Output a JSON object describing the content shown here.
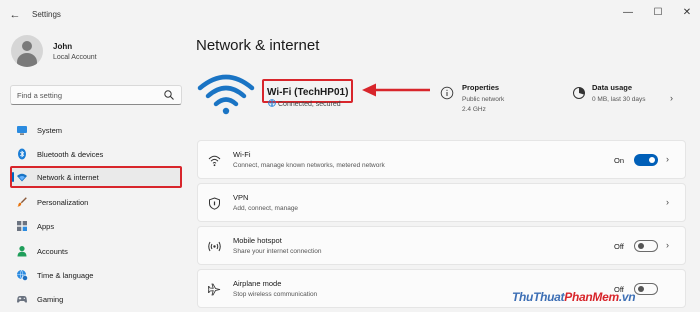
{
  "window": {
    "title": "Settings",
    "back_glyph": "←",
    "minimize_glyph": "—",
    "maximize_glyph": "☐",
    "close_glyph": "✕"
  },
  "user": {
    "name": "John",
    "account": "Local Account"
  },
  "search": {
    "placeholder": "Find a setting",
    "icon": "search-icon"
  },
  "nav": {
    "items": [
      {
        "label": "System",
        "icon": "monitor-icon"
      },
      {
        "label": "Bluetooth & devices",
        "icon": "bluetooth-icon"
      },
      {
        "label": "Network & internet",
        "icon": "wifi-icon",
        "active": true
      },
      {
        "label": "Personalization",
        "icon": "brush-icon"
      },
      {
        "label": "Apps",
        "icon": "apps-icon"
      },
      {
        "label": "Accounts",
        "icon": "person-icon"
      },
      {
        "label": "Time & language",
        "icon": "globe-clock-icon"
      },
      {
        "label": "Gaming",
        "icon": "gamepad-icon"
      }
    ]
  },
  "main": {
    "title": "Network & internet",
    "wifi_name": "Wi-Fi (TechHP01)",
    "wifi_status": "Connected, secured",
    "properties": {
      "title": "Properties",
      "line1": "Public network",
      "line2": "2.4 GHz"
    },
    "data_usage": {
      "title": "Data usage",
      "subtitle": "0 MB, last 30 days"
    },
    "cards": [
      {
        "title": "Wi-Fi",
        "subtitle": "Connect, manage known networks, metered network",
        "state": "On",
        "toggle": true,
        "icon": "wifi-icon"
      },
      {
        "title": "VPN",
        "subtitle": "Add, connect, manage",
        "icon": "shield-icon"
      },
      {
        "title": "Mobile hotspot",
        "subtitle": "Share your internet connection",
        "state": "Off",
        "toggle": false,
        "icon": "hotspot-icon"
      },
      {
        "title": "Airplane mode",
        "subtitle": "Stop wireless communication",
        "state": "Off",
        "toggle": false,
        "icon": "airplane-icon"
      }
    ],
    "chevron": "›"
  },
  "watermark": {
    "part1": "ThuThuat",
    "part2": "PhanMem",
    "part3": ".vn"
  },
  "colors": {
    "accent": "#005fb8",
    "highlight_red": "#d8252b",
    "wifi_blue": "#1a74c4"
  }
}
